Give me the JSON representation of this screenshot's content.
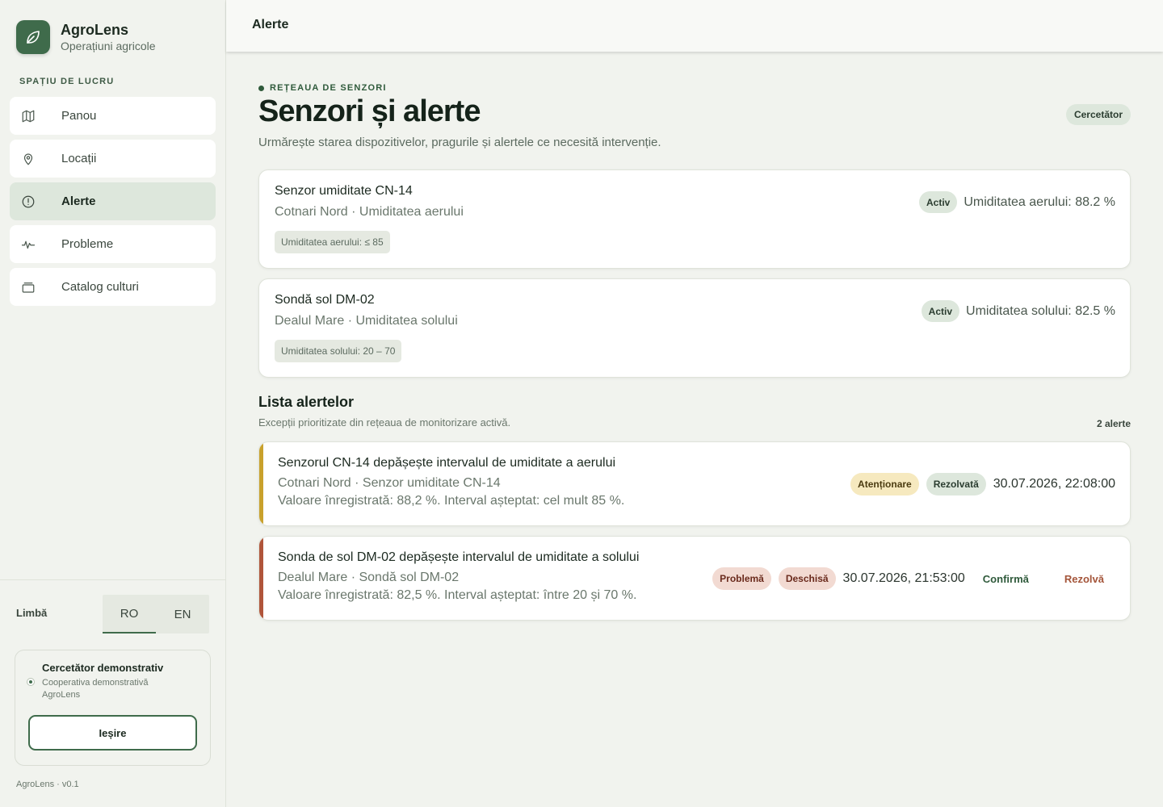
{
  "brand": {
    "name": "AgroLens",
    "subtitle": "Operațiuni agricole"
  },
  "sidebar": {
    "section_label": "SPAȚIU DE LUCRU",
    "items": [
      {
        "label": "Panou",
        "icon": "map-icon",
        "active": false
      },
      {
        "label": "Locații",
        "icon": "location-pin-icon",
        "active": false
      },
      {
        "label": "Alerte",
        "icon": "alert-circle-icon",
        "active": true
      },
      {
        "label": "Probleme",
        "icon": "activity-icon",
        "active": false
      },
      {
        "label": "Catalog culturi",
        "icon": "archive-box-icon",
        "active": false
      }
    ],
    "language_label": "Limbă",
    "languages": [
      "RO",
      "EN"
    ],
    "language_selected": "RO",
    "user": {
      "name": "Cercetător demonstrativ",
      "org": "Cooperativa demonstrativă AgroLens"
    },
    "logout_label": "Ieșire",
    "version": "AgroLens · v0.1"
  },
  "topbar": {
    "title": "Alerte"
  },
  "page": {
    "eyebrow": "REȚEAUA DE SENZORI",
    "title": "Senzori și alerte",
    "role_badge": "Cercetător",
    "description": "Urmărește starea dispozitivelor, pragurile și alertele ce necesită intervenție."
  },
  "sensors": [
    {
      "name": "Senzor umiditate CN-14",
      "location": "Cotnari Nord · Umiditatea aerului",
      "threshold": "Umiditatea aerului: ≤ 85",
      "status": "Activ",
      "reading": "Umiditatea aerului: 88.2 %"
    },
    {
      "name": "Sondă sol DM-02",
      "location": "Dealul Mare · Umiditatea solului",
      "threshold": "Umiditatea solului: 20 – 70",
      "status": "Activ",
      "reading": "Umiditatea solului: 82.5 %"
    }
  ],
  "alerts_section": {
    "title": "Lista alertelor",
    "subtitle": "Excepții prioritizate din rețeaua de monitorizare activă.",
    "count": "2 alerte"
  },
  "alerts": [
    {
      "title": "Senzorul CN-14 depășește intervalul de umiditate a aerului",
      "location": "Cotnari Nord · Senzor umiditate CN-14",
      "value": "Valoare înregistrată: 88,2 %. Interval așteptat: cel mult 85 %.",
      "severity": "Atenționare",
      "state": "Rezolvată",
      "time": "30.07.2026, 22:08:00",
      "bar_color": "#c9a12c"
    },
    {
      "title": "Sonda de sol DM-02 depășește intervalul de umiditate a solului",
      "location": "Dealul Mare · Sondă sol DM-02",
      "value": "Valoare înregistrată: 82,5 %. Interval așteptat: între 20 și 70 %.",
      "severity": "Problemă",
      "state": "Deschisă",
      "time": "30.07.2026, 21:53:00",
      "confirm_label": "Confirmă",
      "resolve_label": "Rezolvă",
      "bar_color": "#b0553a"
    }
  ],
  "colors": {
    "accent": "#3f6b4b",
    "warning": "#c9a12c",
    "problem": "#b0553a"
  }
}
